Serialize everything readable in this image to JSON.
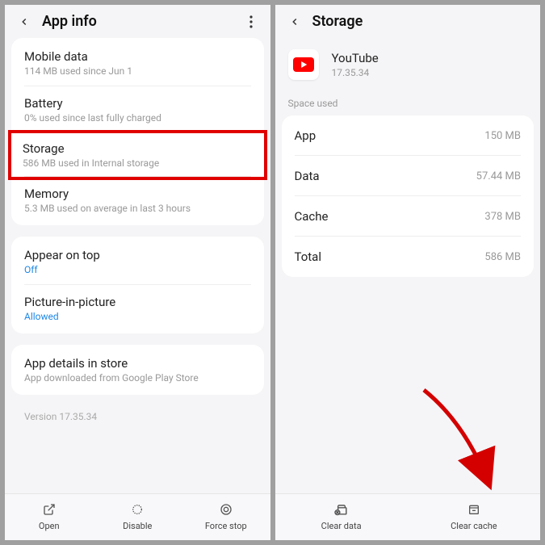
{
  "left": {
    "title": "App info",
    "items": [
      {
        "title": "Mobile data",
        "sub": "114 MB used since Jun 1"
      },
      {
        "title": "Battery",
        "sub": "0% used since last fully charged"
      },
      {
        "title": "Storage",
        "sub": "586 MB used in Internal storage"
      },
      {
        "title": "Memory",
        "sub": "5.3 MB used on average in last 3 hours"
      }
    ],
    "items2": [
      {
        "title": "Appear on top",
        "val": "Off"
      },
      {
        "title": "Picture-in-picture",
        "val": "Allowed"
      }
    ],
    "items3": [
      {
        "title": "App details in store",
        "sub": "App downloaded from Google Play Store"
      }
    ],
    "version": "Version 17.35.34",
    "buttons": {
      "open": "Open",
      "disable": "Disable",
      "force_stop": "Force stop"
    }
  },
  "right": {
    "title": "Storage",
    "app_name": "YouTube",
    "app_version": "17.35.34",
    "section": "Space used",
    "rows": [
      {
        "label": "App",
        "value": "150 MB"
      },
      {
        "label": "Data",
        "value": "57.44 MB"
      },
      {
        "label": "Cache",
        "value": "378 MB"
      },
      {
        "label": "Total",
        "value": "586 MB"
      }
    ],
    "buttons": {
      "clear_data": "Clear data",
      "clear_cache": "Clear cache"
    }
  }
}
